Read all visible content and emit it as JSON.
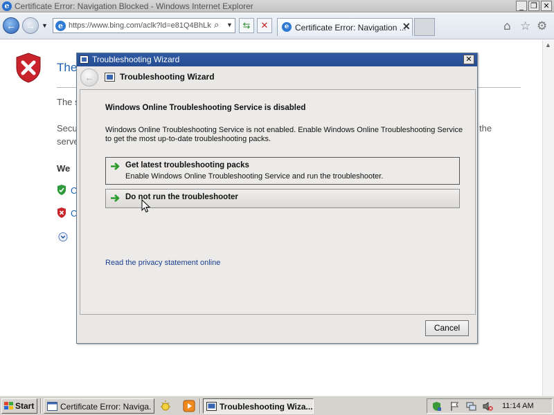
{
  "ie": {
    "title": "Certificate Error: Navigation Blocked - Windows Internet Explorer",
    "address": "https://www.bing.com/aclk?ld=e81Q4BhLk",
    "tab_label": "Certificate Error: Navigation ...",
    "page": {
      "heading": "The",
      "line1": "The s",
      "line2a": "Secu",
      "line2b": "serve",
      "line2_tail": "the",
      "bold": "We",
      "opt1": "C",
      "opt2": "C"
    }
  },
  "dialog": {
    "title": "Troubleshooting Wizard",
    "header": "Troubleshooting Wizard",
    "heading": "Windows Online Troubleshooting Service is disabled",
    "description": "Windows Online Troubleshooting Service is not enabled.  Enable Windows Online Troubleshooting Service to get the most up-to-date troubleshooting packs.",
    "option1": {
      "title": "Get latest troubleshooting packs",
      "desc": "Enable Windows Online Troubleshooting Service and run the troubleshooter."
    },
    "option2": {
      "title": "Do not run the troubleshooter"
    },
    "privacy_link": "Read the privacy statement online",
    "cancel": "Cancel"
  },
  "taskbar": {
    "start": "Start",
    "item_ie": "Certificate Error: Naviga...",
    "item_wizard": "Troubleshooting Wiza...",
    "clock": "11:14 AM"
  },
  "colors": {
    "titlebar_active": "#2f5aa3",
    "link": "#1a3e8f",
    "page_heading": "#1f5fb3"
  }
}
